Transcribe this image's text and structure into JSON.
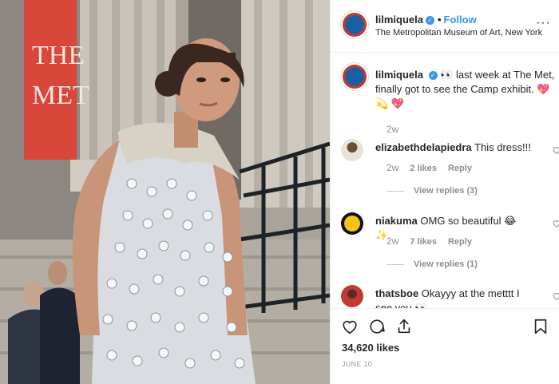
{
  "post": {
    "username": "lilmiquela",
    "follow_label": "Follow",
    "separator": "•",
    "more_label": "···",
    "location": "The Metropolitan Museum of Art, New York",
    "banner_text": [
      "THE",
      "MET"
    ],
    "caption": {
      "username": "lilmiquela",
      "text": "👀 last week at The Met, finally got to see the Camp exhibit. 💖 💫 💖",
      "time": "2w"
    },
    "comments": [
      {
        "username": "elizabethdelapiedra",
        "text": "This dress!!!",
        "time": "2w",
        "likes": "2 likes",
        "reply": "Reply",
        "view_replies": "View replies (3)"
      },
      {
        "username": "niakuma",
        "text": "OMG so beautiful 😂 ✨",
        "time": "2w",
        "likes": "7 likes",
        "reply": "Reply",
        "view_replies": "View replies (1)"
      },
      {
        "username": "thatsboe",
        "text": "Okayyy at the metttt I see you 👀"
      }
    ],
    "likes_count": "34,620 likes",
    "date": "JUNE 10"
  },
  "icons": [
    "heart-icon",
    "comment-icon",
    "share-icon",
    "bookmark-icon",
    "verified-icon",
    "more-options-icon"
  ],
  "colors": {
    "link_blue": "#3897f0",
    "muted_gray": "#8e8e8e",
    "banner_red": "#d8473a",
    "verified_blue": "#3897f0"
  }
}
